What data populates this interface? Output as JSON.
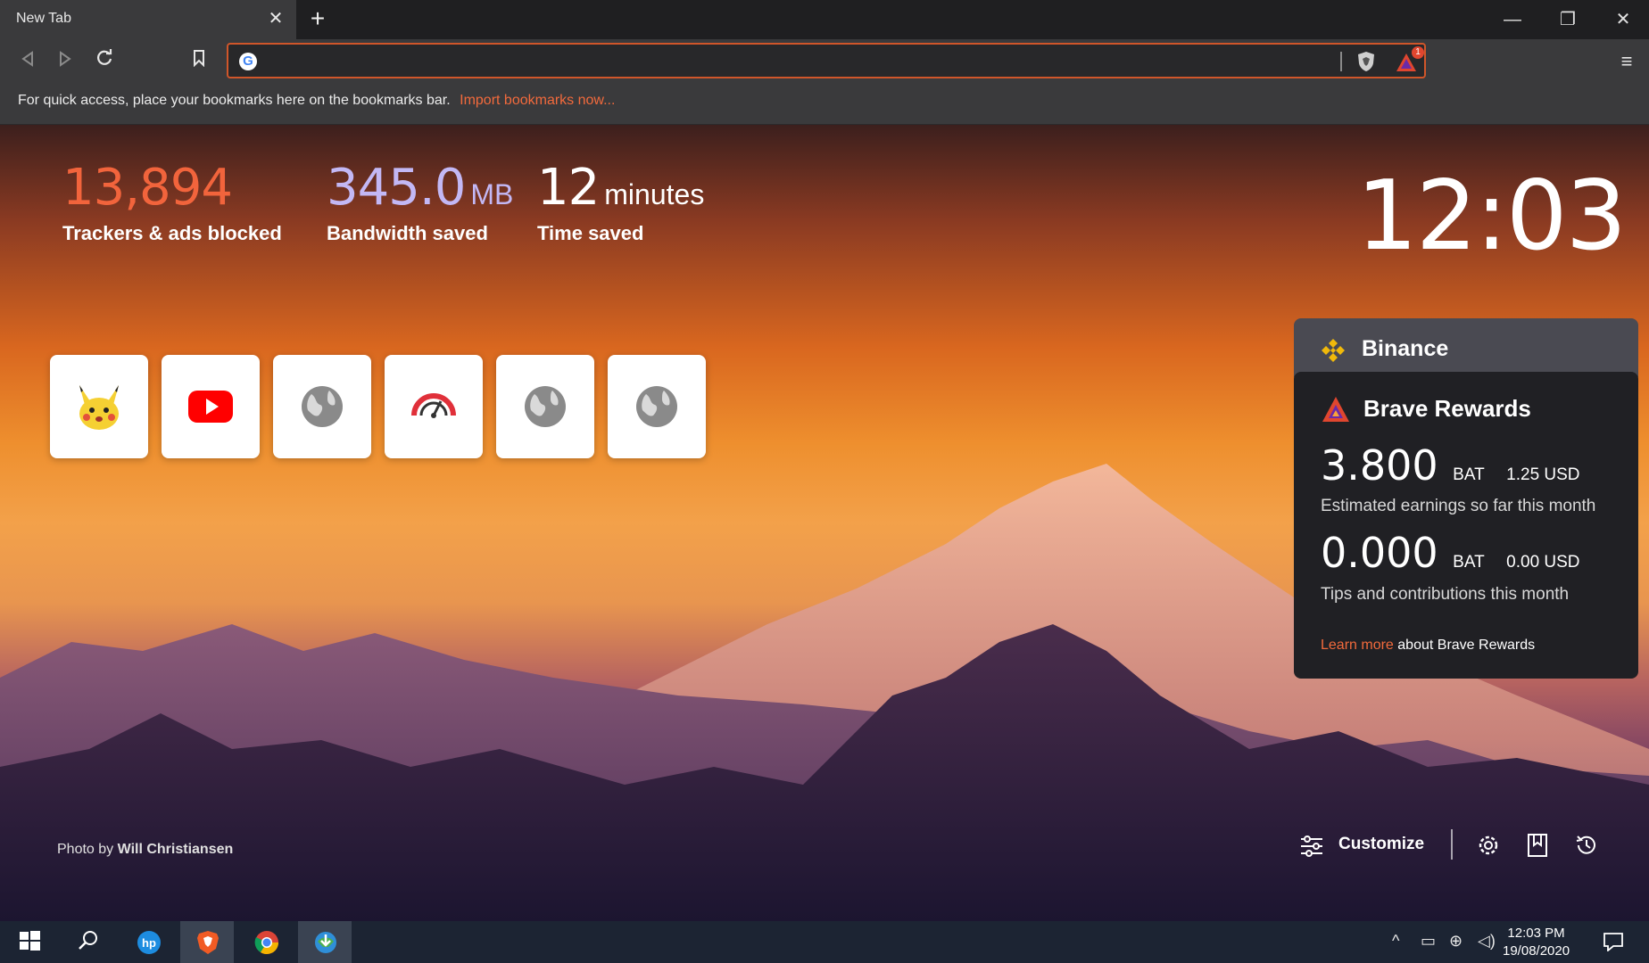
{
  "browser": {
    "tab_title": "New Tab",
    "tab_close": "✕",
    "new_tab": "+",
    "window_controls": {
      "minimize": "—",
      "restore": "❐",
      "close": "✕"
    },
    "url_value": "",
    "rewards_badge": "1",
    "menu_icon": "≡"
  },
  "bookmarks_bar": {
    "message": "For quick access, place your bookmarks here on the bookmarks bar.",
    "import_link": "Import bookmarks now..."
  },
  "stats": {
    "trackers": {
      "value": "13,894",
      "label": "Trackers & ads blocked",
      "color": "#f2643c"
    },
    "bandwidth": {
      "value": "345.0",
      "unit": "MB",
      "label": "Bandwidth saved",
      "color": "#c3b8f5"
    },
    "time": {
      "value": "12",
      "unit": "minutes",
      "label": "Time saved",
      "color": "#ffffff"
    }
  },
  "clock": "12:03",
  "top_sites": [
    {
      "name": "pikachu-icon"
    },
    {
      "name": "youtube-icon"
    },
    {
      "name": "globe-icon"
    },
    {
      "name": "speedometer-icon"
    },
    {
      "name": "globe-icon"
    },
    {
      "name": "globe-icon"
    }
  ],
  "binance": {
    "title": "Binance"
  },
  "rewards": {
    "title": "Brave Rewards",
    "earnings": {
      "amount": "3.800",
      "currency": "BAT",
      "usd": "1.25 USD",
      "desc": "Estimated earnings so far this month"
    },
    "tips": {
      "amount": "0.000",
      "currency": "BAT",
      "usd": "0.00 USD",
      "desc": "Tips and contributions this month"
    },
    "learn_more": "Learn more",
    "footer_rest": "about Brave Rewards"
  },
  "photo_credit": {
    "prefix": "Photo by",
    "author": "Will Christiansen"
  },
  "controls": {
    "customize": "Customize"
  },
  "taskbar": {
    "time": "12:03 PM",
    "date": "19/08/2020"
  },
  "colors": {
    "accent": "#f26a3c",
    "url_border": "#d0562a"
  }
}
